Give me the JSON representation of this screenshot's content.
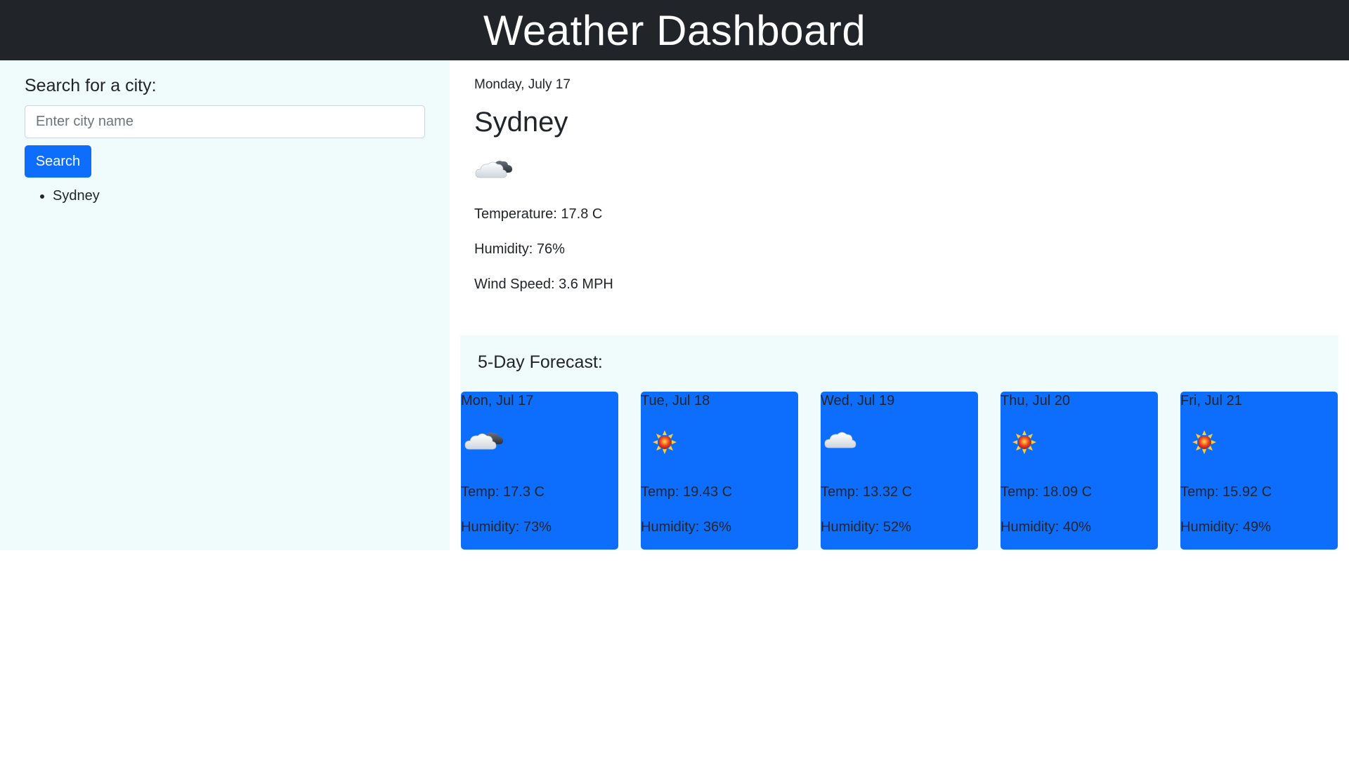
{
  "header": {
    "title": "Weather Dashboard"
  },
  "sidebar": {
    "heading": "Search for a city:",
    "search": {
      "placeholder": "Enter city name",
      "value": ""
    },
    "button_label": "Search",
    "history": [
      "Sydney"
    ]
  },
  "current": {
    "date": "Monday, July 17",
    "city": "Sydney",
    "icon": "partly-cloudy-icon",
    "temperature": "Temperature: 17.8 C",
    "humidity": "Humidity: 76%",
    "wind": "Wind Speed: 3.6 MPH"
  },
  "forecast": {
    "title": "5-Day Forecast:",
    "days": [
      {
        "date": "Mon, Jul 17",
        "icon": "partly-cloudy-icon",
        "temp": "Temp: 17.3 C",
        "humidity": "Humidity: 73%"
      },
      {
        "date": "Tue, Jul 18",
        "icon": "sun-icon",
        "temp": "Temp: 19.43 C",
        "humidity": "Humidity: 36%"
      },
      {
        "date": "Wed, Jul 19",
        "icon": "cloud-icon",
        "temp": "Temp: 13.32 C",
        "humidity": "Humidity: 52%"
      },
      {
        "date": "Thu, Jul 20",
        "icon": "sun-icon",
        "temp": "Temp: 18.09 C",
        "humidity": "Humidity: 40%"
      },
      {
        "date": "Fri, Jul 21",
        "icon": "sun-icon",
        "temp": "Temp: 15.92 C",
        "humidity": "Humidity: 49%"
      }
    ]
  },
  "colors": {
    "header_bg": "#212529",
    "panel_bg": "#f0fcfc",
    "accent": "#0d6efd"
  }
}
